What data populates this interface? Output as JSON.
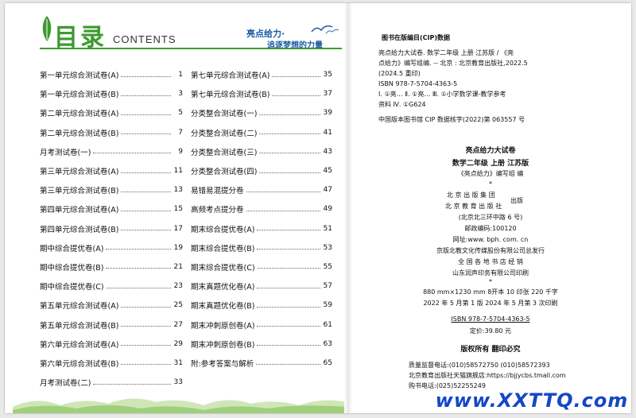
{
  "header": {
    "title_zh": "目录",
    "title_en": "CONTENTS",
    "brand": "亮点给力·",
    "slogan": "追逐梦想的力量"
  },
  "toc_left": [
    {
      "label": "第一单元综合测试卷(A)",
      "page": "1"
    },
    {
      "label": "第一单元综合测试卷(B)",
      "page": "3"
    },
    {
      "label": "第二单元综合测试卷(A)",
      "page": "5"
    },
    {
      "label": "第二单元综合测试卷(B)",
      "page": "7"
    },
    {
      "label": "月考测试卷(一)",
      "page": "9"
    },
    {
      "label": "第三单元综合测试卷(A)",
      "page": "11"
    },
    {
      "label": "第三单元综合测试卷(B)",
      "page": "13"
    },
    {
      "label": "第四单元综合测试卷(A)",
      "page": "15"
    },
    {
      "label": "第四单元综合测试卷(B)",
      "page": "17"
    },
    {
      "label": "期中综合提优卷(A)",
      "page": "19"
    },
    {
      "label": "期中综合提优卷(B)",
      "page": "21"
    },
    {
      "label": "期中综合提优卷(C)",
      "page": "23"
    },
    {
      "label": "第五单元综合测试卷(A)",
      "page": "25"
    },
    {
      "label": "第五单元综合测试卷(B)",
      "page": "27"
    },
    {
      "label": "第六单元综合测试卷(A)",
      "page": "29"
    },
    {
      "label": "第六单元综合测试卷(B)",
      "page": "31"
    },
    {
      "label": "月考测试卷(二)",
      "page": "33"
    }
  ],
  "toc_right": [
    {
      "label": "第七单元综合测试卷(A)",
      "page": "35"
    },
    {
      "label": "第七单元综合测试卷(B)",
      "page": "37"
    },
    {
      "label": "分类整合测试卷(一)",
      "page": "39"
    },
    {
      "label": "分类整合测试卷(二)",
      "page": "41"
    },
    {
      "label": "分类整合测试卷(三)",
      "page": "43"
    },
    {
      "label": "分类整合测试卷(四)",
      "page": "45"
    },
    {
      "label": "易错易混提分卷",
      "page": "47"
    },
    {
      "label": "高频考点提分卷",
      "page": "49"
    },
    {
      "label": "期末综合提优卷(A)",
      "page": "51"
    },
    {
      "label": "期末综合提优卷(B)",
      "page": "53"
    },
    {
      "label": "期末综合提优卷(C)",
      "page": "55"
    },
    {
      "label": "期末真题优化卷(A)",
      "page": "57"
    },
    {
      "label": "期末真题优化卷(B)",
      "page": "59"
    },
    {
      "label": "期末冲刺原创卷(A)",
      "page": "61"
    },
    {
      "label": "期末冲刺原创卷(B)",
      "page": "63"
    },
    {
      "label": "附:参考答案与解析",
      "page": "65"
    }
  ],
  "cip": {
    "heading": "图书在版编目(CIP)数据",
    "lines": [
      "亮点给力大试卷. 数学二年级 上册 江苏版 / 《亮",
      "点给力》编写组编. -- 北京 : 北京教育出版社,2022.5",
      "(2024.5 重印)",
      "ISBN 978-7-5704-4363-5",
      "Ⅰ. ①亮…  Ⅱ. ①亮…  Ⅲ. ①小学数学课-教学参考",
      "资料  Ⅳ. ①G624",
      "中国版本图书馆 CIP 数据核字(2022)第 063557 号"
    ]
  },
  "book": {
    "title": "亮点给力大试卷",
    "subtitle": "数学二年级   上册   江苏版",
    "editor": "《亮点给力》编写组   编",
    "star1": "*",
    "pub_line1": "北 京 出 版 集 团",
    "pub_line2": "北 京 教 育 出 版 社",
    "pub_suffix": "出版",
    "address": "(北京北三环中路 6 号)",
    "postcode": "邮政编码:100120",
    "website": "网址:www. bph. com. cn",
    "distributor": "京版北教文化传媒股份有限公司总发行",
    "sellers": "全 国 各 地 书 店 经 销",
    "printer": "山东润声印务有限公司印刷",
    "star2": "*",
    "specs": "880 mm×1230 mm   8开本   10 印张   220 千字",
    "edition": "2022 年 5 月第 1 版      2024 年 5 月第 3 次印刷",
    "isbn": "ISBN 978-7-5704-4363-5",
    "price": "定价:39.80 元",
    "rights": "版权所有   翻印必究",
    "qc_phone": "质量监督电话:(010)58572750   (010)58572393",
    "shop": "北京教育出版社天猫旗舰店:https://bjjycbs.tmall.com",
    "buy_phone": "购书电话:(025)52255249"
  },
  "watermark": "www.XXTTQ.com",
  "colors": {
    "green": "#3d9a2f",
    "blue": "#1b5aa8",
    "watermark": "#1447c8"
  }
}
